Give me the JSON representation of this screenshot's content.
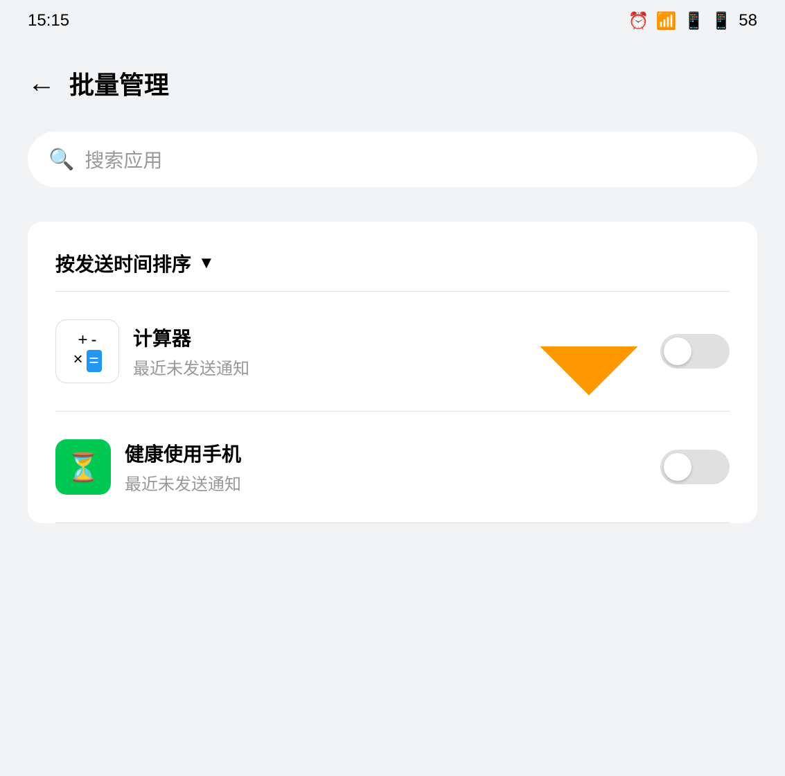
{
  "status_bar": {
    "time": "15:15",
    "alarm_icon": "alarm-icon",
    "wifi_icon": "wifi-icon",
    "signal_icon_4g": "4g-signal-icon",
    "signal_icon_4g2": "4g-signal-icon",
    "battery_level": "58"
  },
  "header": {
    "title": "批量管理",
    "back_icon": "back-arrow-icon"
  },
  "search": {
    "placeholder": "搜索应用",
    "icon": "search-icon"
  },
  "sort": {
    "label": "按发送时间排序",
    "icon": "dropdown-icon"
  },
  "apps": [
    {
      "name": "计算器",
      "status": "最近未发送通知",
      "icon_type": "calculator",
      "toggle_state": "off"
    },
    {
      "name": "健康使用手机",
      "status": "最近未发送通知",
      "icon_type": "health",
      "toggle_state": "off"
    }
  ],
  "arrow_color": "#ff9800"
}
